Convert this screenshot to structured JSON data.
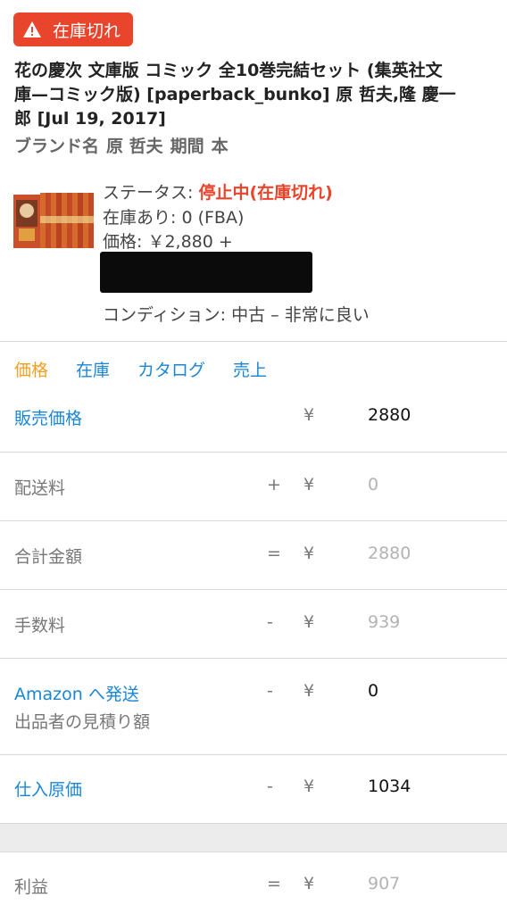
{
  "badge": {
    "icon": "warning-icon",
    "label": "在庫切れ"
  },
  "product": {
    "title_lines": [
      "花の慶次 文庫版 コミック 全10巻完結セット (集英社文",
      "庫—コミック版) [paperback_bunko] 原 哲夫,隆 慶一",
      "郎 [Jul 19, 2017]"
    ],
    "brand_label": "ブランド名",
    "brand_value": "原 哲夫",
    "period_label": "期間",
    "period_value": "本"
  },
  "info": {
    "status_label": "ステータス: ",
    "status_value": "停止中(在庫切れ)",
    "stock": "在庫あり: 0 (FBA)",
    "price": "価格: ￥2,880 +",
    "condition": "コンディション: 中古 – 非常に良い"
  },
  "tabs": [
    "価格",
    "在庫",
    "カタログ",
    "売上"
  ],
  "active_tab": "価格",
  "rows": {
    "sale_price": {
      "label": "販売価格",
      "op": "",
      "currency": "¥",
      "value": "2880"
    },
    "shipping": {
      "label": "配送料",
      "op": "+",
      "currency": "¥",
      "value": "0"
    },
    "total": {
      "label": "合計金額",
      "op": "=",
      "currency": "¥",
      "value": "2880"
    },
    "fee": {
      "label": "手数料",
      "op": "-",
      "currency": "¥",
      "value": "939"
    },
    "amazon_ship": {
      "label": "Amazon へ発送",
      "sublabel": "出品者の見積り額",
      "op": "-",
      "currency": "¥",
      "value": "0"
    },
    "cost": {
      "label": "仕入原価",
      "op": "-",
      "currency": "¥",
      "value": "1034"
    },
    "profit": {
      "label": "利益",
      "op": "=",
      "currency": "¥",
      "value": "907"
    }
  },
  "colors": {
    "accent_red": "#e8452c",
    "link_blue": "#1a86d4",
    "active_tab": "#f0a020"
  }
}
